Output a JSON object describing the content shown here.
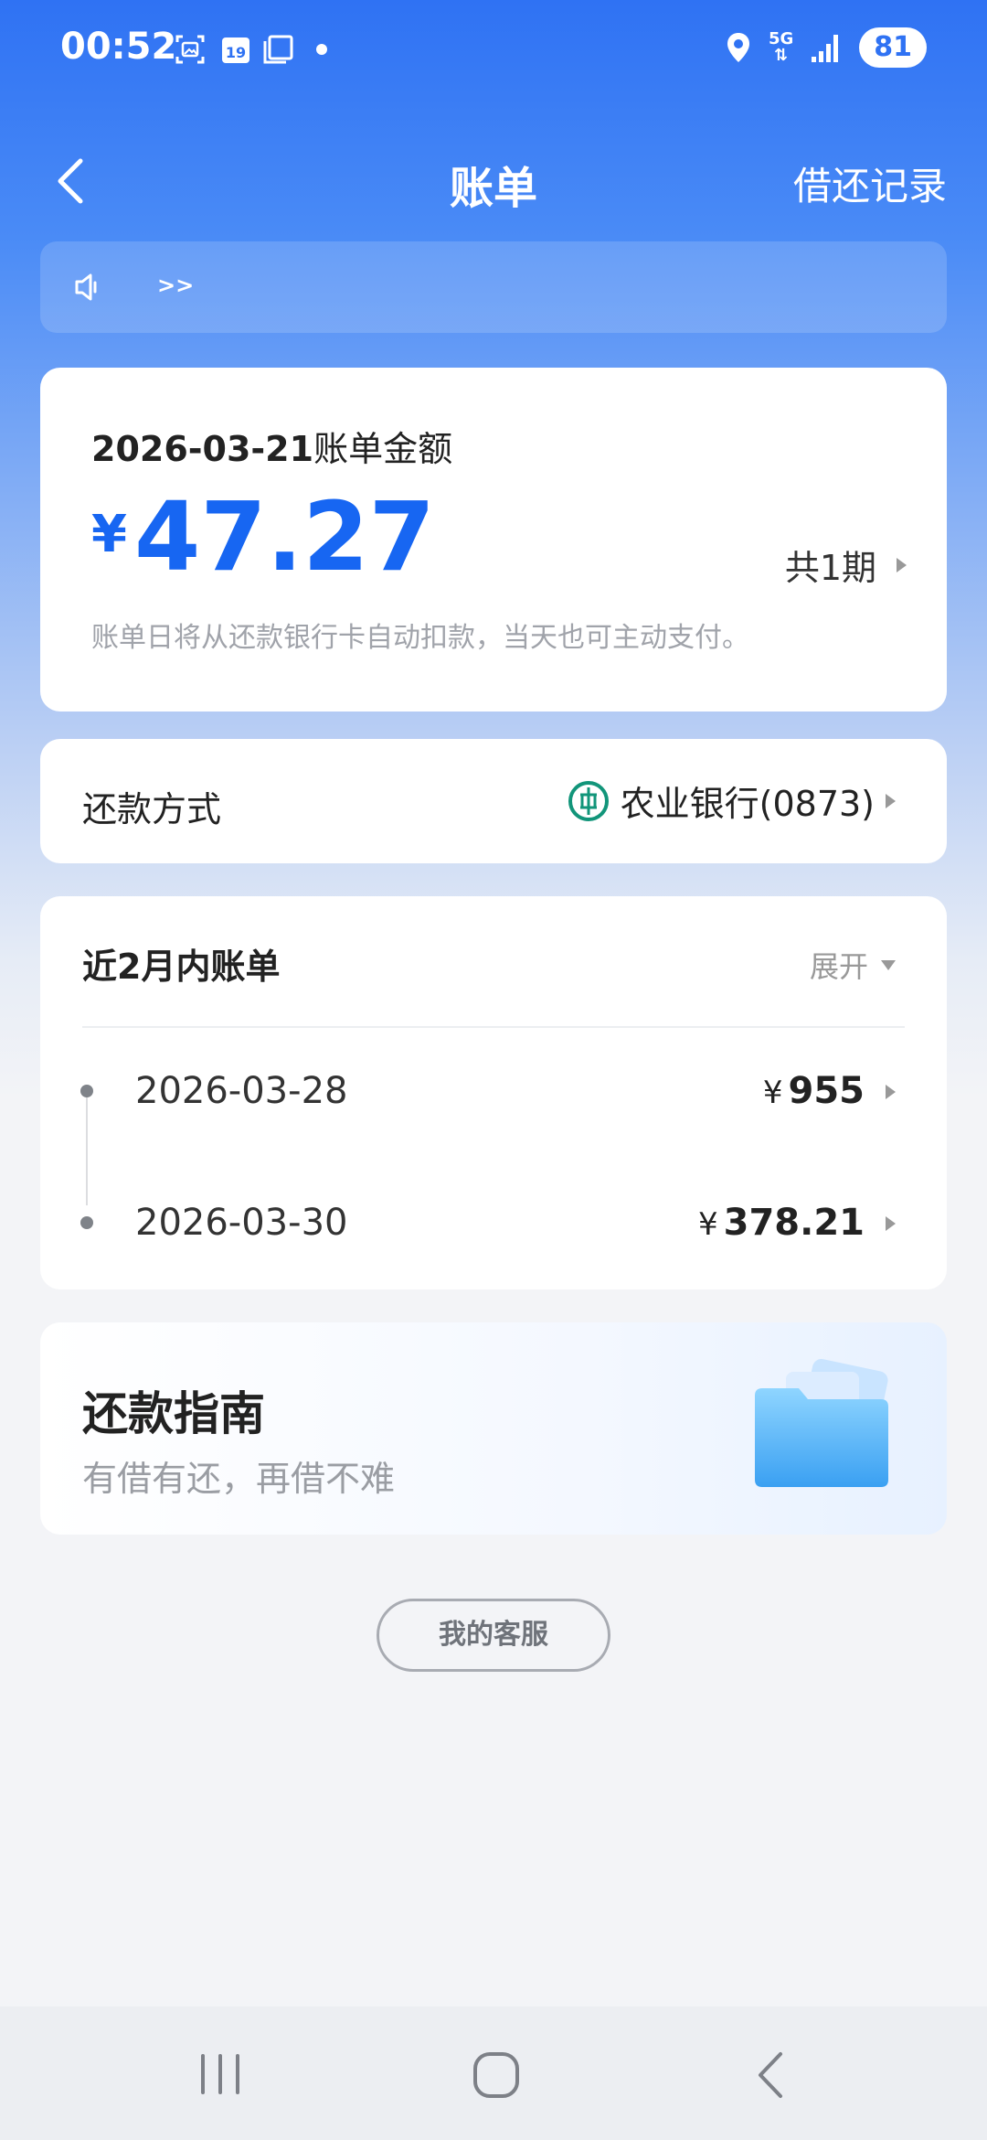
{
  "status_bar": {
    "time": "00:52",
    "calendar_day": "19",
    "network": "5G",
    "battery": "81"
  },
  "nav": {
    "title": "账单",
    "right_action": "借还记录"
  },
  "notice": {
    "more": ">>"
  },
  "bill": {
    "date": "2026-03-21",
    "title_suffix": "账单金额",
    "currency": "¥",
    "amount": "47.27",
    "periods": "共1期",
    "note": "账单日将从还款银行卡自动扣款，当天也可主动支付。"
  },
  "repayment": {
    "label": "还款方式",
    "bank": "农业银行(0873)"
  },
  "recent": {
    "title": "近2月内账单",
    "expand": "展开",
    "items": [
      {
        "date": "2026-03-28",
        "currency": "¥",
        "amount": "955"
      },
      {
        "date": "2026-03-30",
        "currency": "¥",
        "amount": "378.21"
      }
    ]
  },
  "guide": {
    "title": "还款指南",
    "subtitle": "有借有还，再借不难"
  },
  "service_button": "我的客服",
  "colors": {
    "accent": "#1766f2",
    "header_blue": "#2f72f3",
    "bank_green": "#12957a"
  }
}
